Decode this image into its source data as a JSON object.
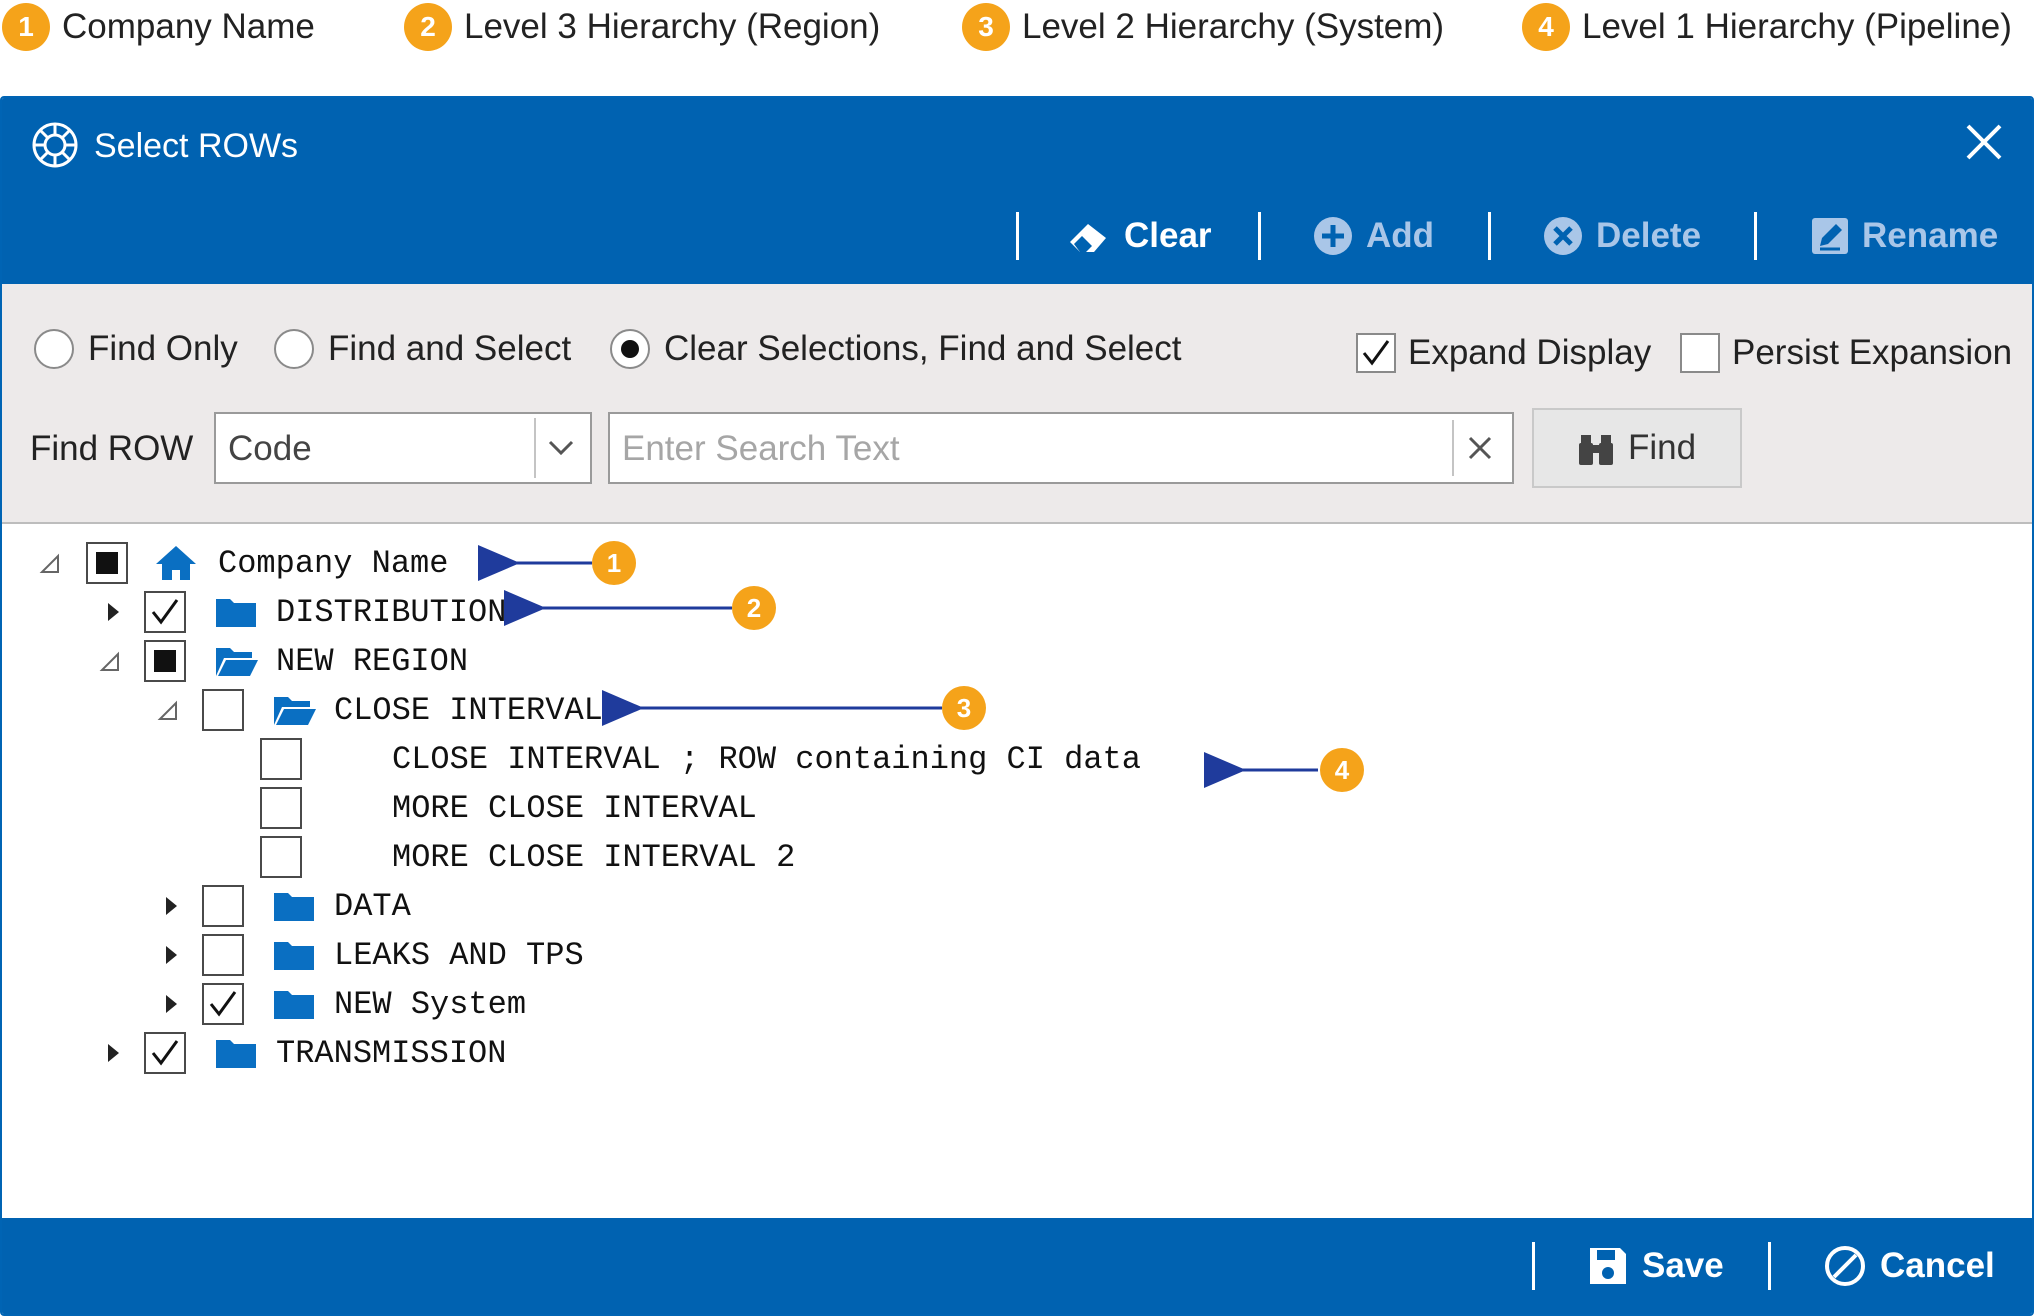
{
  "legend": [
    {
      "num": "1",
      "text": "Company Name"
    },
    {
      "num": "2",
      "text": "Level 3 Hierarchy (Region)"
    },
    {
      "num": "3",
      "text": "Level 2 Hierarchy (System)"
    },
    {
      "num": "4",
      "text": "Level 1 Hierarchy (Pipeline)"
    }
  ],
  "dialog": {
    "title": "Select ROWs",
    "toolbar": {
      "clear": "Clear",
      "add": "Add",
      "delete": "Delete",
      "rename": "Rename"
    },
    "options": {
      "find_only": "Find Only",
      "find_and_select": "Find and Select",
      "clear_find_select": "Clear Selections, Find and Select",
      "expand_display": "Expand Display",
      "persist_expansion": "Persist Expansion"
    },
    "find": {
      "label": "Find ROW",
      "field_value": "Code",
      "placeholder": "Enter Search Text",
      "button": "Find"
    },
    "tree": {
      "company": "Company Name",
      "distribution": "DISTRIBUTION",
      "new_region": "NEW REGION",
      "close_interval": "CLOSE INTERVAL",
      "row1": "CLOSE INTERVAL ; ROW containing CI data",
      "row2": "MORE CLOSE INTERVAL",
      "row3": "MORE CLOSE INTERVAL 2",
      "data": "DATA",
      "leaks": "LEAKS AND TPS",
      "new_system": "NEW System",
      "transmission": "TRANSMISSION"
    },
    "annotations": [
      "1",
      "2",
      "3",
      "4"
    ],
    "footer": {
      "save": "Save",
      "cancel": "Cancel"
    }
  },
  "colors": {
    "accent": "#0062b1",
    "badge": "#f5a31a",
    "arrow": "#1f3b9c",
    "folder": "#0a6fc2"
  }
}
